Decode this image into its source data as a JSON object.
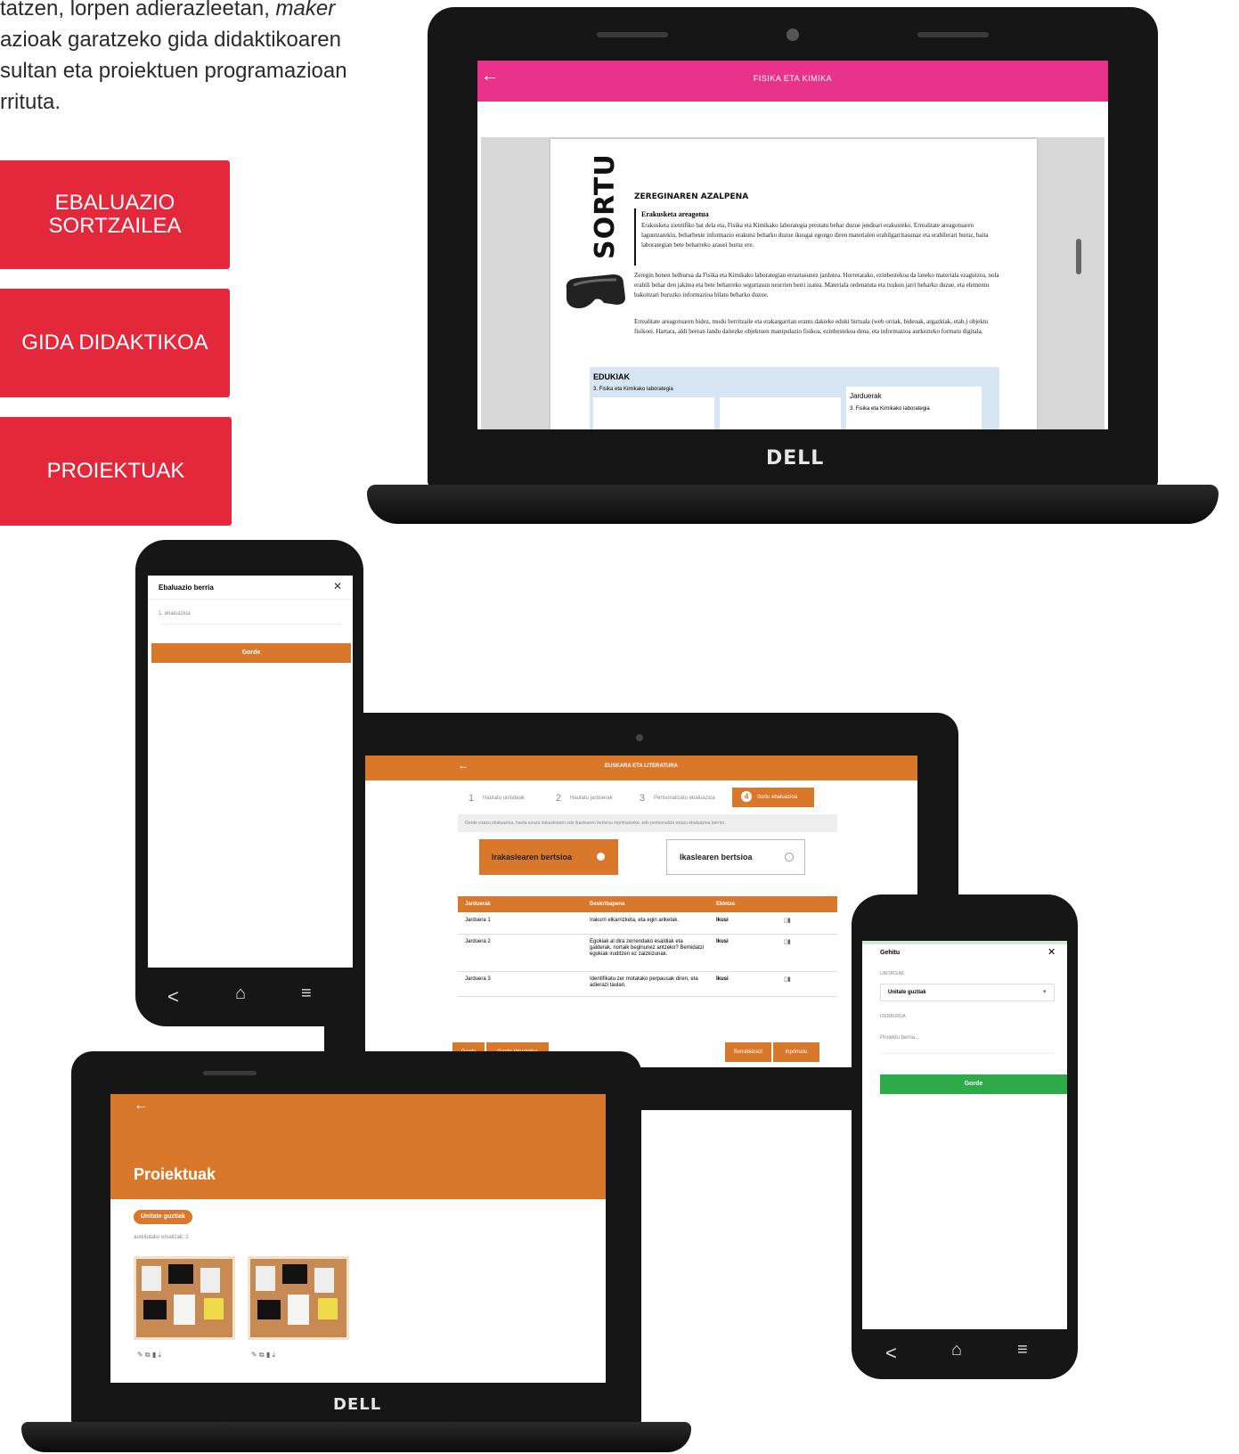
{
  "intro": {
    "line1_a": "tatzen, lorpen adierazleetan, ",
    "line1_em": "maker",
    "line2": "azioak garatzeko gida didaktikoaren",
    "line3": "sultan eta proiektuen programazioan",
    "line4": "rrituta."
  },
  "side_buttons": [
    {
      "label": "EBALUAZIO\nSORTZAILEA"
    },
    {
      "label": "GIDA DIDAKTIKOA"
    },
    {
      "label": "PROIEKTUAK"
    }
  ],
  "laptop_top": {
    "brand": "DELL",
    "header_title": "FISIKA ETA KIMIKA",
    "header_color": "#e9338a",
    "doc": {
      "side_title": "SORTU",
      "section_title": "ZEREGINAREN AZALPENA",
      "subtitle": "Erakusketa areagotua",
      "para1": "Erakusketa zientifiko bat dela eta, Fisika eta Kimikako laborategia prestatu behar duzue jendeari erakusteko. Errealitate areagotuaren laguntzarekin, beharbeste informazio erakutsi beharko duzue ikusgai egongo diren materialen erabilgarritasunaz eta erabilerari buruz, baita laborategian bete beharreko arauei buruz ere.",
      "para2": "Zeregin honen helburua da Fisika eta Kimikako laborategian erraztasunez jarduteа. Horretarako, ezinbestekoa da laneko materiala ezagutzea, nola erabili behar den jakitea eta bete beharreko segurtasun neurrien berri izatea. Materiala ordenatuta eta txukun jarri beharko duzue, eta elementu bakoitzari buruzko informazioa bilatu beharko duzue.",
      "para3": "Errealitate areagotuaren bidez, modu berritzaile eta erakargarrian erants dakieke eduki birtuala (web orriak, bideoak, argazkiak, etab.) objektu fisikoei. Hartara, aldi berean landu daitezke objektuen manipulazio fisikoa, ezinbestekoa dena, eta informazioa aurkezteko formatu digitala.",
      "edukiak_label": "EDUKIAK",
      "edukiak_item": "3. Fisika eta Kimikako laborategia",
      "jarduerak_label": "Jarduerak",
      "jarduerak_item": "3. Fisika eta Kimikako laborategia"
    }
  },
  "phone_left": {
    "dialog_title": "Ebaluazio berria",
    "input_value": "1. ebaluazioa",
    "save_label": "Gorde",
    "accent": "#d9782a"
  },
  "tablet": {
    "header_title": "EUSKARA ETA LITERATURA",
    "steps": [
      {
        "num": "1",
        "label": "Hautatu unitateak"
      },
      {
        "num": "2",
        "label": "Hautatu jarduerak"
      },
      {
        "num": "3",
        "label": "Pertsonalizatu ebaluazioa"
      },
      {
        "num": "4",
        "label": "Sortu ebaluazioa"
      }
    ],
    "info_text": "Gorde ezazu ebaluazioa, hauta ezazu irakaslearen edo ikaslearen bertsioa inprimatzeko, edo pertsonaliza ezazu ebaluazioa berriro.",
    "version_teacher": "Irakaslearen bertsioa",
    "version_student": "Ikaslearen bertsioa",
    "table_headers": [
      "Jarduerak",
      "Deskribapena",
      "Ekintza"
    ],
    "rows": [
      {
        "name": "Jarduera 1",
        "desc": "Irakurri elkarrizketa, eta egin ariketak.",
        "action": "Ikusi"
      },
      {
        "name": "Jarduera 2",
        "desc": "Egokiak al dira zerrendako esaldiak eta galderak, nortaik beginunez antzeko? Bernidatzi egokiak iruditzen ez zaizkizunak.",
        "action": "Ikusi"
      },
      {
        "name": "Jarduera 3",
        "desc": "Identifikatu zer motatako perpausak diren, eta adierazi taulan.",
        "action": "Ikusi"
      }
    ],
    "footer_buttons": [
      "Gorde",
      "Gorde Wordetiko",
      "Berrabiarazi",
      "Inprimatu"
    ],
    "accent": "#d9782a"
  },
  "laptop_bottom": {
    "brand": "DELL",
    "title": "Proiektuak",
    "filter_chip": "Unitate guztiak",
    "results_text": "aurkitutako emaitzak: 2",
    "accent": "#d9782a"
  },
  "phone_right": {
    "dialog_title": "Gehitu",
    "unit_label": "UNITATEAK",
    "unit_value": "Unitate guztiak",
    "name_label": "IZENBURUA",
    "name_placeholder": "Proiektu berria...",
    "save_label": "Gorde",
    "accent": "#2eaa4b"
  }
}
